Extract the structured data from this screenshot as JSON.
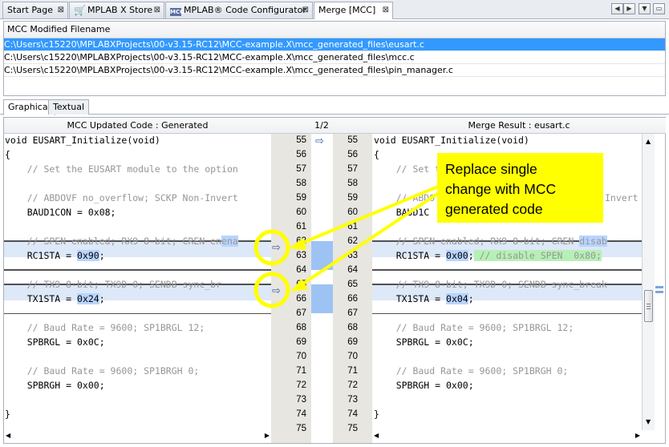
{
  "tabs": [
    {
      "label": "Start Page",
      "icon": "none",
      "close": "⊠"
    },
    {
      "label": "MPLAB X Store",
      "icon": "cart-icon",
      "close": "⊠"
    },
    {
      "label": "MPLAB® Code Configurator",
      "icon": "mcc-icon",
      "close": "⊠"
    },
    {
      "label": "Merge [MCC]",
      "icon": "none",
      "close": "⊠"
    }
  ],
  "mcc_icon_text": "MCC",
  "nav": {
    "left": "◀",
    "right": "▶",
    "down": "▼",
    "restore": "▭"
  },
  "filelist": {
    "header": "MCC Modified Filename",
    "rows": [
      "C:\\Users\\c15220\\MPLABXProjects\\00-v3.15-RC12\\MCC-example.X\\mcc_generated_files\\eusart.c",
      "C:\\Users\\c15220\\MPLABXProjects\\00-v3.15-RC12\\MCC-example.X\\mcc_generated_files\\mcc.c",
      "C:\\Users\\c15220\\MPLABXProjects\\00-v3.15-RC12\\MCC-example.X\\mcc_generated_files\\pin_manager.c"
    ]
  },
  "subtabs": [
    "Graphical",
    "Textual"
  ],
  "diff": {
    "left_header": "MCC Updated Code : Generated",
    "center_header": "1/2",
    "right_header": "Merge Result : eusart.c",
    "line_numbers": [
      "55",
      "56",
      "57",
      "58",
      "59",
      "60",
      "61",
      "62",
      "63",
      "64",
      "65",
      "66",
      "67",
      "68",
      "69",
      "70",
      "71",
      "72",
      "73",
      "74",
      "75"
    ],
    "left_lines": [
      "void EUSART_Initialize(void)",
      "{",
      "    // Set the EUSART module to the option",
      "",
      "    // ABDOVF no_overflow; SCKP Non-Invert",
      "    BAUD1CON = 0x08;",
      "",
      "    // SPEN enabled; RX9 8-bit; CREN en",
      "    RC1STA = 0x90;",
      "",
      "    // TX9 8-bit; TX9D 0; SENDB sync_br",
      "    TX1STA = 0x24;",
      "",
      "    // Baud Rate = 9600; SP1BRGL 12;",
      "    SPBRGL = 0x0C;",
      "",
      "    // Baud Rate = 9600; SP1BRGH 0;",
      "    SPBRGH = 0x00;",
      "",
      "}",
      ""
    ],
    "right_lines": [
      "void EUSART_Initialize(void)",
      "{",
      "    // Set the EUSART module to the optio",
      "",
      "    // ABDO",
      "    BAUD1C",
      "",
      "    // SPEN enabled; RX9 8-bit; CREN ",
      "    RC1STA = 0x00;",
      "",
      "    // TX9 8-bit; TX9D 0; SENDB sync_break",
      "    TX1STA = 0x04;",
      "",
      "    // Baud Rate = 9600; SP1BRGL 12;",
      "    SPBRGL = 0x0C;",
      "",
      "    // Baud Rate = 9600; SP1BRGH 0;",
      "    SPBRGH = 0x00;",
      "",
      "}",
      ""
    ],
    "left_hl_62": "ena",
    "right_hl_62": "disab",
    "left_val_63": "0x90",
    "right_val_63": "0x00",
    "right_cm_63": " // disable SPEN  0x80;",
    "left_val_66": "0x24",
    "right_val_66": "0x04",
    "right_invert_60": "Invert"
  },
  "annotation": {
    "text_lines": [
      "Replace single",
      "change with MCC",
      "generated code"
    ],
    "box_color": "#ffff00",
    "circle_color": "#ffff00"
  },
  "colors": {
    "selection": "#3399ff",
    "change_band": "#b9d4ff",
    "gutter": "#e8e6e0",
    "change_gutter": "#9dc3f5"
  }
}
